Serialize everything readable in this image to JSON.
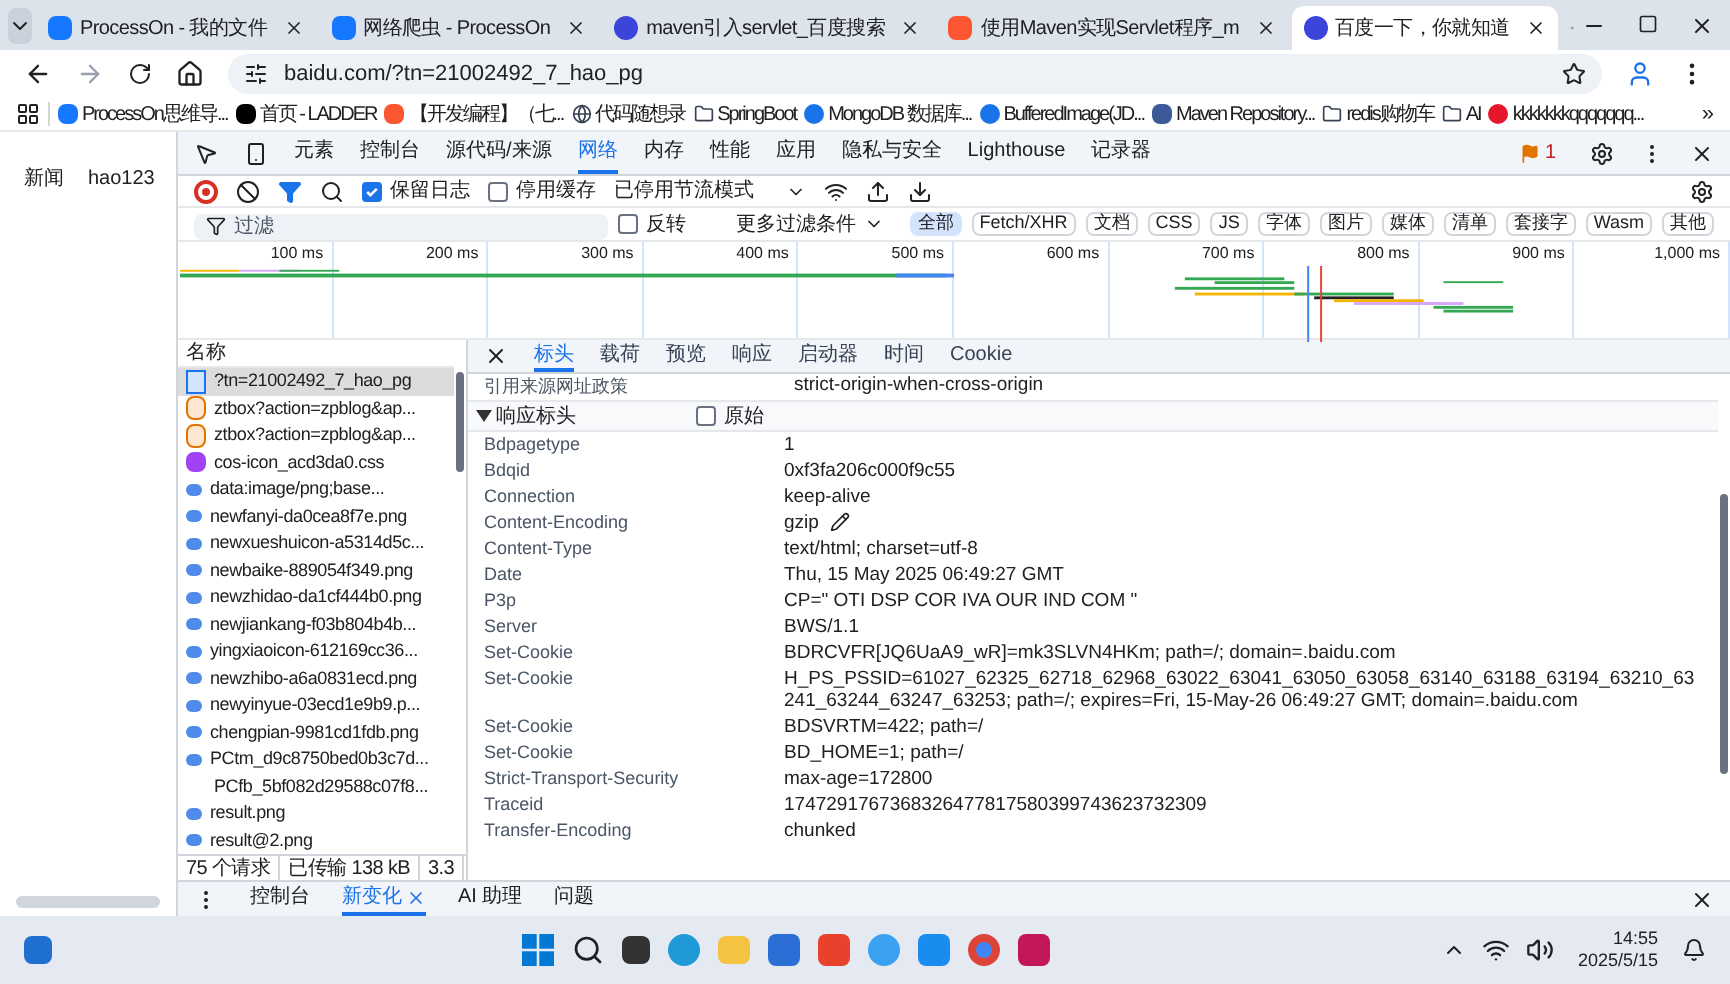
{
  "browser_tabs": [
    {
      "title": "ProcessOn - 我的文件",
      "kind": "processon",
      "selected": false
    },
    {
      "title": "网络爬虫 - ProcessOn",
      "kind": "processon",
      "selected": false
    },
    {
      "title": "maven引入servlet_百度搜索",
      "kind": "baidu",
      "selected": false
    },
    {
      "title": "使用Maven实现Servlet程序_m",
      "kind": "csdn",
      "selected": false
    },
    {
      "title": "百度一下，你就知道",
      "kind": "baidu",
      "selected": true
    }
  ],
  "address": "baidu.com/?tn=21002492_7_hao_pg",
  "bookmarks": [
    {
      "label": "ProcessOn思维导...",
      "kind": "processon"
    },
    {
      "label": "首页 - LADDER",
      "kind": "ladder"
    },
    {
      "label": "【开发编程】（七...",
      "kind": "csdn"
    },
    {
      "label": "代码随想录",
      "kind": "globe"
    },
    {
      "label": "SpringBoot",
      "kind": "folder"
    },
    {
      "label": "MongoDB 数据库...",
      "kind": "site"
    },
    {
      "label": "BufferedImage(JD...",
      "kind": "site"
    },
    {
      "label": "Maven Repository...",
      "kind": "maven"
    },
    {
      "label": "redis购物车",
      "kind": "folder"
    },
    {
      "label": "AI",
      "kind": "folder"
    },
    {
      "label": "kkkkkkkqqqqqqq...",
      "kind": "weibo"
    }
  ],
  "bookmarks_more": "»",
  "page_links": [
    "新闻",
    "hao123"
  ],
  "devtools": {
    "tabs": [
      {
        "label": "元素",
        "selected": false
      },
      {
        "label": "控制台",
        "selected": false
      },
      {
        "label": "源代码/来源",
        "selected": false
      },
      {
        "label": "网络",
        "selected": true
      },
      {
        "label": "内存",
        "selected": false
      },
      {
        "label": "性能",
        "selected": false
      },
      {
        "label": "应用",
        "selected": false
      },
      {
        "label": "隐私与安全",
        "selected": false
      },
      {
        "label": "Lighthouse",
        "selected": false
      },
      {
        "label": "记录器",
        "selected": false
      }
    ],
    "issues_count": "1",
    "checkboxes": [
      {
        "label": "保留日志",
        "checked": true
      },
      {
        "label": "停用缓存",
        "checked": false
      }
    ],
    "throttling": "已停用节流模式",
    "filter": {
      "placeholder": "过滤",
      "invert": {
        "label": "反转",
        "checked": false
      },
      "more_filters": "更多过滤条件",
      "types": [
        {
          "label": "全部",
          "selected": true
        },
        {
          "label": "Fetch/XHR",
          "selected": false
        },
        {
          "label": "文档",
          "selected": false
        },
        {
          "label": "CSS",
          "selected": false
        },
        {
          "label": "JS",
          "selected": false
        },
        {
          "label": "字体",
          "selected": false
        },
        {
          "label": "图片",
          "selected": false
        },
        {
          "label": "媒体",
          "selected": false
        },
        {
          "label": "清单",
          "selected": false
        },
        {
          "label": "套接字",
          "selected": false
        },
        {
          "label": "Wasm",
          "selected": false
        },
        {
          "label": "其他",
          "selected": false
        }
      ]
    },
    "timeline_ticks": [
      "100 ms",
      "200 ms",
      "300 ms",
      "400 ms",
      "500 ms",
      "600 ms",
      "700 ms",
      "800 ms",
      "900 ms",
      "1,000 ms"
    ],
    "requests": {
      "header": "名称",
      "rows": [
        {
          "name": "?tn=21002492_7_hao_pg",
          "kind": "document",
          "selected": true
        },
        {
          "name": "ztbox?action=zpblog&ap...",
          "kind": "script",
          "selected": false
        },
        {
          "name": "ztbox?action=zpblog&ap...",
          "kind": "script",
          "selected": false
        },
        {
          "name": "cos-icon_acd3da0.css",
          "kind": "stylesheet",
          "selected": false
        },
        {
          "name": "data:image/png;base...",
          "kind": "image",
          "selected": false
        },
        {
          "name": "newfanyi-da0cea8f7e.png",
          "kind": "image",
          "selected": false
        },
        {
          "name": "newxueshuicon-a5314d5c...",
          "kind": "image",
          "selected": false
        },
        {
          "name": "newbaike-889054f349.png",
          "kind": "image",
          "selected": false
        },
        {
          "name": "newzhidao-da1cf444b0.png",
          "kind": "image",
          "selected": false
        },
        {
          "name": "newjiankang-f03b804b4b...",
          "kind": "image",
          "selected": false
        },
        {
          "name": "yingxiaoicon-612169cc36...",
          "kind": "image",
          "selected": false
        },
        {
          "name": "newzhibo-a6a0831ecd.png",
          "kind": "image",
          "selected": false
        },
        {
          "name": "newyinyue-03ecd1e9b9.p...",
          "kind": "image",
          "selected": false
        },
        {
          "name": "chengpian-9981cd1fdb.png",
          "kind": "image",
          "selected": false
        },
        {
          "name": "PCtm_d9c8750bed0b3c7d...",
          "kind": "image",
          "selected": false
        },
        {
          "name": "PCfb_5bf082d29588c07f8...",
          "kind": "blank",
          "selected": false
        },
        {
          "name": "result.png",
          "kind": "image",
          "selected": false
        },
        {
          "name": "result@2.png",
          "kind": "image",
          "selected": false
        }
      ]
    },
    "status": [
      "75 个请求",
      "已传输 138 kB",
      "3.3"
    ],
    "detail": {
      "tabs": [
        {
          "label": "标头",
          "selected": true
        },
        {
          "label": "载荷",
          "selected": false
        },
        {
          "label": "预览",
          "selected": false
        },
        {
          "label": "响应",
          "selected": false
        },
        {
          "label": "启动器",
          "selected": false
        },
        {
          "label": "时间",
          "selected": false
        },
        {
          "label": "Cookie",
          "selected": false
        }
      ],
      "policy": {
        "name": "引用来源网址政策",
        "value": "strict-origin-when-cross-origin"
      },
      "section": {
        "title": "响应标头",
        "expanded": true,
        "raw": {
          "label": "原始",
          "checked": false
        }
      },
      "headers": [
        {
          "name": "Bdpagetype",
          "value": "1"
        },
        {
          "name": "Bdqid",
          "value": "0xf3fa206c000f9c55"
        },
        {
          "name": "Connection",
          "value": "keep-alive"
        },
        {
          "name": "Content-Encoding",
          "value": "gzip",
          "editable": true
        },
        {
          "name": "Content-Type",
          "value": "text/html; charset=utf-8"
        },
        {
          "name": "Date",
          "value": "Thu, 15 May 2025 06:49:27 GMT"
        },
        {
          "name": "P3p",
          "value": "CP=\" OTI DSP COR IVA OUR IND COM \""
        },
        {
          "name": "Server",
          "value": "BWS/1.1"
        },
        {
          "name": "Set-Cookie",
          "value": "BDRCVFR[JQ6UaA9_wR]=mk3SLVN4HKm; path=/; domain=.baidu.com"
        },
        {
          "name": "Set-Cookie",
          "value": "H_PS_PSSID=61027_62325_62718_62968_63022_63041_63050_63058_63140_63188_63194_63210_63241_63244_63247_63253; path=/; expires=Fri, 15-May-26 06:49:27 GMT; domain=.baidu.com"
        },
        {
          "name": "Set-Cookie",
          "value": "BDSVRTM=422; path=/"
        },
        {
          "name": "Set-Cookie",
          "value": "BD_HOME=1; path=/"
        },
        {
          "name": "Strict-Transport-Security",
          "value": "max-age=172800"
        },
        {
          "name": "Traceid",
          "value": "1747291767368326477817580399743623732309"
        },
        {
          "name": "Transfer-Encoding",
          "value": "chunked"
        }
      ]
    }
  },
  "drawer_tabs": [
    {
      "label": "控制台",
      "selected": false,
      "closable": false
    },
    {
      "label": "新变化",
      "selected": true,
      "closable": true
    },
    {
      "label": "AI 助理",
      "selected": false,
      "closable": false
    },
    {
      "label": "问题",
      "selected": false,
      "closable": false
    }
  ],
  "taskbar": {
    "time": "14:55",
    "date": "2025/5/15"
  }
}
